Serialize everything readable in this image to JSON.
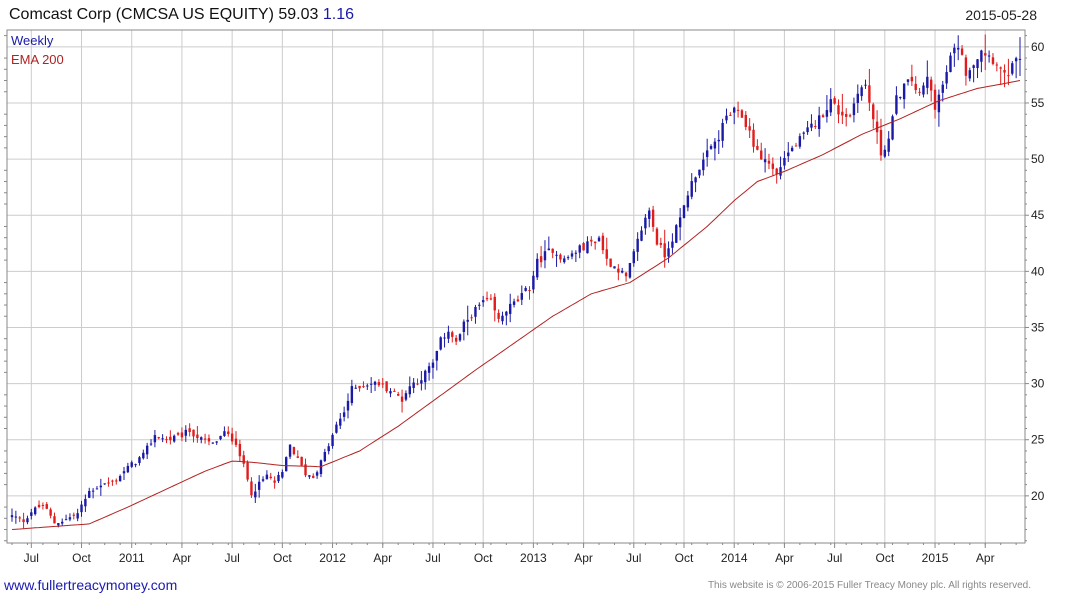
{
  "header": {
    "title_main": "Comcast Corp (CMCSA US EQUITY) 59.03",
    "title_change": "1.16",
    "date": "2015-05-28"
  },
  "footer": {
    "left": "www.fullertreacymoney.com",
    "right": "This website is © 2006-2015 Fuller Treacy Money plc. All rights reserved."
  },
  "colors": {
    "up": "#1a1aa6",
    "down": "#e01c1c",
    "ema": "#b22222",
    "grid": "#cccccc",
    "frame": "#888888"
  },
  "chart_data": {
    "type": "candlestick",
    "legend": [
      {
        "name": "Weekly",
        "color": "#1a1aa6"
      },
      {
        "name": "EMA 200",
        "color": "#b22222"
      }
    ],
    "ylim": [
      15.8,
      61.5
    ],
    "yticks": [
      20,
      25,
      30,
      35,
      40,
      45,
      50,
      55,
      60
    ],
    "xticks": [
      "Jul",
      "Oct",
      "2011",
      "Apr",
      "Jul",
      "Oct",
      "2012",
      "Apr",
      "Jul",
      "Oct",
      "2013",
      "Apr",
      "Jul",
      "Oct",
      "2014",
      "Apr",
      "Jul",
      "Oct",
      "2015",
      "Apr"
    ],
    "xtick_weeks": [
      5,
      18,
      31,
      44,
      57,
      70,
      83,
      96,
      109,
      122,
      135,
      148,
      161,
      174,
      187,
      200,
      213,
      226,
      239,
      252
    ],
    "weeks": 262,
    "anchors": [
      [
        0,
        18.2
      ],
      [
        3,
        17.8
      ],
      [
        5,
        18.6
      ],
      [
        8,
        19.2
      ],
      [
        11,
        17.6
      ],
      [
        14,
        17.9
      ],
      [
        17,
        18.4
      ],
      [
        20,
        20.4
      ],
      [
        23,
        21.0
      ],
      [
        26,
        21.2
      ],
      [
        30,
        22.5
      ],
      [
        34,
        23.6
      ],
      [
        37,
        25.4
      ],
      [
        40,
        25.0
      ],
      [
        43,
        25.2
      ],
      [
        46,
        25.8
      ],
      [
        49,
        25.0
      ],
      [
        52,
        24.6
      ],
      [
        55,
        25.6
      ],
      [
        58,
        24.8
      ],
      [
        60,
        22.6
      ],
      [
        62,
        20.3
      ],
      [
        64,
        21.0
      ],
      [
        66,
        21.8
      ],
      [
        68,
        21.2
      ],
      [
        70,
        22.0
      ],
      [
        72,
        24.5
      ],
      [
        74,
        23.2
      ],
      [
        76,
        22.0
      ],
      [
        78,
        21.7
      ],
      [
        80,
        23.0
      ],
      [
        82,
        24.5
      ],
      [
        84,
        26.2
      ],
      [
        86,
        27.5
      ],
      [
        88,
        29.5
      ],
      [
        90,
        29.8
      ],
      [
        92,
        30.0
      ],
      [
        95,
        30.0
      ],
      [
        98,
        29.4
      ],
      [
        101,
        28.6
      ],
      [
        103,
        29.8
      ],
      [
        106,
        30.5
      ],
      [
        109,
        31.8
      ],
      [
        111,
        33.8
      ],
      [
        113,
        34.8
      ],
      [
        115,
        33.6
      ],
      [
        117,
        35.2
      ],
      [
        119,
        36.2
      ],
      [
        122,
        37.3
      ],
      [
        124,
        37.2
      ],
      [
        126,
        35.6
      ],
      [
        128,
        36.6
      ],
      [
        131,
        37.4
      ],
      [
        134,
        38.6
      ],
      [
        136,
        40.8
      ],
      [
        138,
        41.5
      ],
      [
        140,
        42.0
      ],
      [
        143,
        41.0
      ],
      [
        146,
        41.8
      ],
      [
        149,
        42.4
      ],
      [
        152,
        43.0
      ],
      [
        154,
        41.0
      ],
      [
        157,
        40.2
      ],
      [
        159,
        39.4
      ],
      [
        161,
        41.5
      ],
      [
        163,
        43.8
      ],
      [
        165,
        45.5
      ],
      [
        167,
        42.6
      ],
      [
        169,
        41.5
      ],
      [
        171,
        43.0
      ],
      [
        173,
        44.6
      ],
      [
        175,
        47.0
      ],
      [
        177,
        48.7
      ],
      [
        180,
        50.4
      ],
      [
        183,
        52.0
      ],
      [
        185,
        53.8
      ],
      [
        187,
        54.2
      ],
      [
        189,
        53.8
      ],
      [
        191,
        52.4
      ],
      [
        193,
        50.5
      ],
      [
        196,
        49.6
      ],
      [
        198,
        48.6
      ],
      [
        200,
        50.2
      ],
      [
        203,
        51.3
      ],
      [
        206,
        52.5
      ],
      [
        209,
        53.6
      ],
      [
        212,
        55.2
      ],
      [
        214,
        54.2
      ],
      [
        217,
        53.8
      ],
      [
        219,
        56.2
      ],
      [
        221,
        56.5
      ],
      [
        223,
        53.6
      ],
      [
        225,
        50.5
      ],
      [
        227,
        51.8
      ],
      [
        229,
        55.3
      ],
      [
        231,
        56.5
      ],
      [
        233,
        57.0
      ],
      [
        235,
        55.6
      ],
      [
        237,
        57.2
      ],
      [
        239,
        54.8
      ],
      [
        241,
        56.5
      ],
      [
        243,
        59.0
      ],
      [
        245,
        60.2
      ],
      [
        247,
        57.8
      ],
      [
        249,
        58.6
      ],
      [
        251,
        59.8
      ],
      [
        253,
        59.2
      ],
      [
        255,
        58.6
      ],
      [
        257,
        57.3
      ],
      [
        259,
        58.2
      ],
      [
        261,
        59.03
      ]
    ],
    "ema_anchors": [
      [
        0,
        17.0
      ],
      [
        20,
        17.5
      ],
      [
        30,
        19.0
      ],
      [
        40,
        20.6
      ],
      [
        50,
        22.2
      ],
      [
        57,
        23.1
      ],
      [
        62,
        23.0
      ],
      [
        70,
        22.7
      ],
      [
        80,
        22.6
      ],
      [
        90,
        24.0
      ],
      [
        100,
        26.2
      ],
      [
        110,
        28.7
      ],
      [
        120,
        31.2
      ],
      [
        130,
        33.6
      ],
      [
        140,
        36.0
      ],
      [
        150,
        38.0
      ],
      [
        160,
        39.0
      ],
      [
        170,
        41.2
      ],
      [
        180,
        44.0
      ],
      [
        187,
        46.3
      ],
      [
        193,
        48.0
      ],
      [
        200,
        48.9
      ],
      [
        210,
        50.4
      ],
      [
        220,
        52.2
      ],
      [
        230,
        53.6
      ],
      [
        240,
        55.2
      ],
      [
        250,
        56.3
      ],
      [
        258,
        56.8
      ],
      [
        261,
        57.0
      ]
    ]
  }
}
